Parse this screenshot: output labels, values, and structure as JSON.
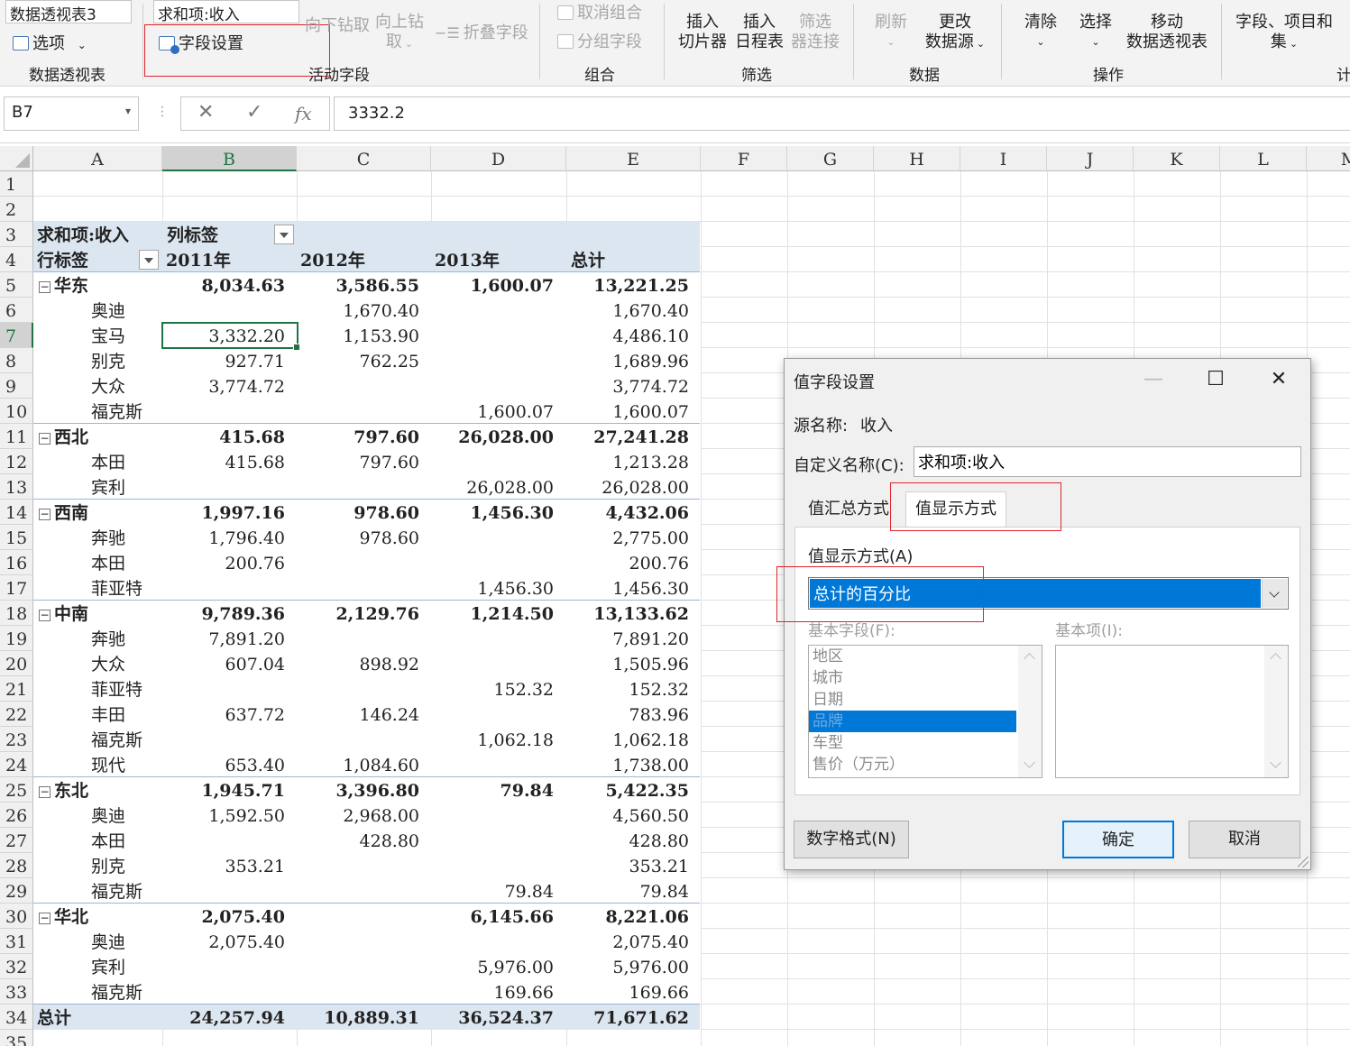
{
  "ribbon": {
    "pivot_name": "数据透视表3",
    "options_label": "选项",
    "group_pivot_label": "数据透视表",
    "active_field_value": "求和项:收入",
    "field_settings_label": "字段设置",
    "drill_down_label": "向下钻取",
    "drill_up_label_1": "向上钻",
    "drill_up_label_2": "取",
    "collapse_label": "折叠字段",
    "group_active_label": "活动字段",
    "ungroup_label": "取消组合",
    "group_field_label": "分组字段",
    "group_group_label": "组合",
    "slicer_label_1": "插入",
    "slicer_label_2": "切片器",
    "timeline_label_1": "插入",
    "timeline_label_2": "日程表",
    "filter_conn_label_1": "筛选",
    "filter_conn_label_2": "器连接",
    "group_filter_label": "筛选",
    "refresh_label": "刷新",
    "change_source_label_1": "更改",
    "change_source_label_2": "数据源",
    "group_data_label": "数据",
    "clear_label": "清除",
    "select_label": "选择",
    "move_label_1": "移动",
    "move_label_2": "数据透视表",
    "group_ops_label": "操作",
    "fields_items_label_1": "字段、项目和",
    "fields_items_label_2": "集",
    "group_calc_label": "计"
  },
  "formula_bar": {
    "name_box": "B7",
    "cancel_icon": "✕",
    "enter_icon": "✓",
    "fx_label": "fx",
    "value": "3332.2"
  },
  "columns": [
    "A",
    "B",
    "C",
    "D",
    "E",
    "F",
    "G",
    "H",
    "I",
    "J",
    "K",
    "L",
    "M"
  ],
  "rows_count": 35,
  "selected_cell": "B7",
  "pivot": {
    "value_field": "求和项:收入",
    "col_label": "列标签",
    "row_label": "行标签",
    "years": [
      "2011年",
      "2012年",
      "2013年",
      "总计"
    ],
    "rows": [
      {
        "label": "华东",
        "level": 0,
        "values": [
          "8,034.63",
          "3,586.55",
          "1,600.07",
          "13,221.25"
        ]
      },
      {
        "label": "奥迪",
        "level": 1,
        "values": [
          "",
          "1,670.40",
          "",
          "1,670.40"
        ]
      },
      {
        "label": "宝马",
        "level": 1,
        "values": [
          "3,332.20",
          "1,153.90",
          "",
          "4,486.10"
        ]
      },
      {
        "label": "别克",
        "level": 1,
        "values": [
          "927.71",
          "762.25",
          "",
          "1,689.96"
        ]
      },
      {
        "label": "大众",
        "level": 1,
        "values": [
          "3,774.72",
          "",
          "",
          "3,774.72"
        ]
      },
      {
        "label": "福克斯",
        "level": 1,
        "values": [
          "",
          "",
          "1,600.07",
          "1,600.07"
        ]
      },
      {
        "label": "西北",
        "level": 0,
        "values": [
          "415.68",
          "797.60",
          "26,028.00",
          "27,241.28"
        ]
      },
      {
        "label": "本田",
        "level": 1,
        "values": [
          "415.68",
          "797.60",
          "",
          "1,213.28"
        ]
      },
      {
        "label": "宾利",
        "level": 1,
        "values": [
          "",
          "",
          "26,028.00",
          "26,028.00"
        ]
      },
      {
        "label": "西南",
        "level": 0,
        "values": [
          "1,997.16",
          "978.60",
          "1,456.30",
          "4,432.06"
        ]
      },
      {
        "label": "奔驰",
        "level": 1,
        "values": [
          "1,796.40",
          "978.60",
          "",
          "2,775.00"
        ]
      },
      {
        "label": "本田",
        "level": 1,
        "values": [
          "200.76",
          "",
          "",
          "200.76"
        ]
      },
      {
        "label": "菲亚特",
        "level": 1,
        "values": [
          "",
          "",
          "1,456.30",
          "1,456.30"
        ]
      },
      {
        "label": "中南",
        "level": 0,
        "values": [
          "9,789.36",
          "2,129.76",
          "1,214.50",
          "13,133.62"
        ]
      },
      {
        "label": "奔驰",
        "level": 1,
        "values": [
          "7,891.20",
          "",
          "",
          "7,891.20"
        ]
      },
      {
        "label": "大众",
        "level": 1,
        "values": [
          "607.04",
          "898.92",
          "",
          "1,505.96"
        ]
      },
      {
        "label": "菲亚特",
        "level": 1,
        "values": [
          "",
          "",
          "152.32",
          "152.32"
        ]
      },
      {
        "label": "丰田",
        "level": 1,
        "values": [
          "637.72",
          "146.24",
          "",
          "783.96"
        ]
      },
      {
        "label": "福克斯",
        "level": 1,
        "values": [
          "",
          "",
          "1,062.18",
          "1,062.18"
        ]
      },
      {
        "label": "现代",
        "level": 1,
        "values": [
          "653.40",
          "1,084.60",
          "",
          "1,738.00"
        ]
      },
      {
        "label": "东北",
        "level": 0,
        "values": [
          "1,945.71",
          "3,396.80",
          "79.84",
          "5,422.35"
        ]
      },
      {
        "label": "奥迪",
        "level": 1,
        "values": [
          "1,592.50",
          "2,968.00",
          "",
          "4,560.50"
        ]
      },
      {
        "label": "本田",
        "level": 1,
        "values": [
          "",
          "428.80",
          "",
          "428.80"
        ]
      },
      {
        "label": "别克",
        "level": 1,
        "values": [
          "353.21",
          "",
          "",
          "353.21"
        ]
      },
      {
        "label": "福克斯",
        "level": 1,
        "values": [
          "",
          "",
          "79.84",
          "79.84"
        ]
      },
      {
        "label": "华北",
        "level": 0,
        "values": [
          "2,075.40",
          "",
          "6,145.66",
          "8,221.06"
        ]
      },
      {
        "label": "奥迪",
        "level": 1,
        "values": [
          "2,075.40",
          "",
          "",
          "2,075.40"
        ]
      },
      {
        "label": "宾利",
        "level": 1,
        "values": [
          "",
          "",
          "5,976.00",
          "5,976.00"
        ]
      },
      {
        "label": "福克斯",
        "level": 1,
        "values": [
          "",
          "",
          "169.66",
          "169.66"
        ]
      },
      {
        "label": "总计",
        "level": 2,
        "values": [
          "24,257.94",
          "10,889.31",
          "36,524.37",
          "71,671.62"
        ]
      }
    ]
  },
  "dialog": {
    "title": "值字段设置",
    "minimize_icon": "—",
    "maximize_icon": "☐",
    "close_icon": "✕",
    "source_label": "源名称:",
    "source_value": "收入",
    "custom_name_label": "自定义名称(C):",
    "custom_name_value": "求和项:收入",
    "tab_summarize": "值汇总方式",
    "tab_show_as": "值显示方式",
    "show_as_label": "值显示方式(A)",
    "show_as_value": "总计的百分比",
    "base_field_label": "基本字段(F):",
    "base_item_label": "基本项(I):",
    "base_fields": [
      "地区",
      "城市",
      "日期",
      "品牌",
      "车型",
      "售价（万元）"
    ],
    "base_field_selected_index": 3,
    "number_format_button": "数字格式(N)",
    "ok_button": "确定",
    "cancel_button": "取消"
  }
}
